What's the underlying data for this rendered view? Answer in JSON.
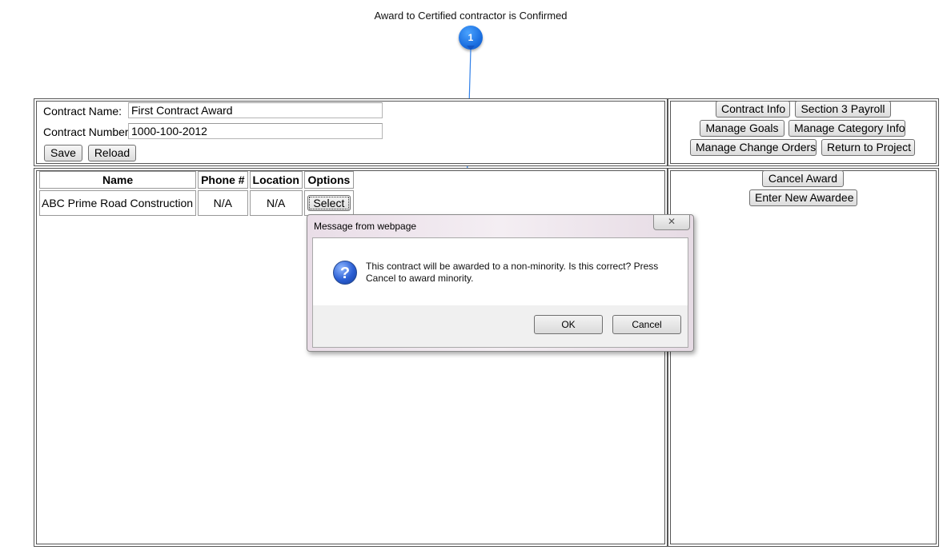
{
  "caption": "Award to Certified contractor is Confirmed",
  "callout_number": "1",
  "contract_form": {
    "name_label": "Contract Name:",
    "name_value": "First Contract Award",
    "number_label": "Contract Number:",
    "number_value": "1000-100-2012",
    "save_label": "Save",
    "reload_label": "Reload"
  },
  "actions": {
    "contract_info": "Contract Info",
    "section3_payroll": "Section 3 Payroll",
    "manage_goals": "Manage Goals",
    "manage_category_info": "Manage Category Info",
    "manage_change_orders": "Manage Change Orders",
    "return_to_project": "Return to Project"
  },
  "award_actions": {
    "cancel_award": "Cancel Award",
    "enter_new_awardee": "Enter New Awardee"
  },
  "table": {
    "headers": [
      "Name",
      "Phone #",
      "Location",
      "Options"
    ],
    "rows": [
      {
        "name": "ABC Prime Road Construction",
        "phone": "N/A",
        "location": "N/A",
        "option": "Select"
      }
    ]
  },
  "dialog": {
    "title": "Message from webpage",
    "close_glyph": "✕",
    "icon": "question-icon",
    "message": "This contract will be awarded to a non-minority. Is this correct? Press Cancel to award minority.",
    "ok_label": "OK",
    "cancel_label": "Cancel"
  }
}
